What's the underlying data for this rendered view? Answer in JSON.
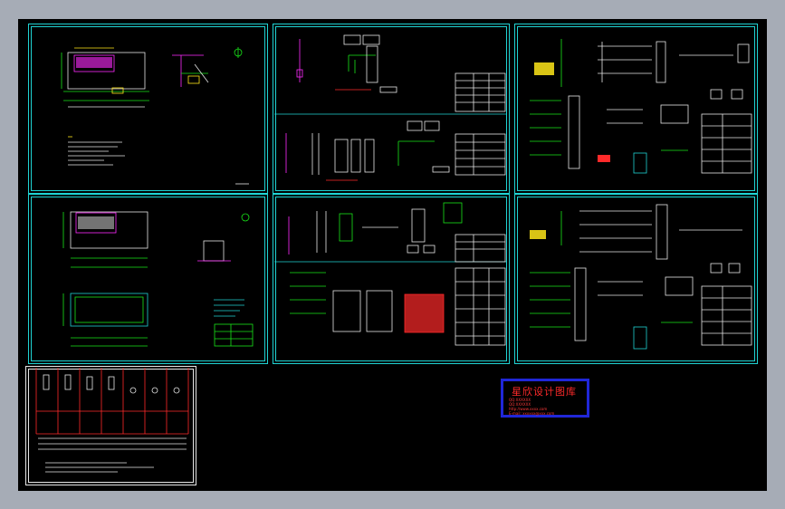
{
  "colors": {
    "background": "#a6acb6",
    "canvas": "#000000",
    "frame": "#1fd3d3",
    "stamp_border": "#2027d8",
    "stamp_text": "#ff2a2a",
    "line_green": "#19e619",
    "line_magenta": "#ff2bff",
    "line_white": "#e6e6e6",
    "line_red": "#ff2a2a",
    "line_yellow": "#ffe619",
    "line_cyan": "#1fd3d3"
  },
  "stamp": {
    "title": "星欣设计图库",
    "line1": "QQ:XXXXXX",
    "line2": "QQ:XXXXXX",
    "line3": "http://www.xxxx.com",
    "line4": "E-mail: xxxxxx@xxx.com"
  }
}
